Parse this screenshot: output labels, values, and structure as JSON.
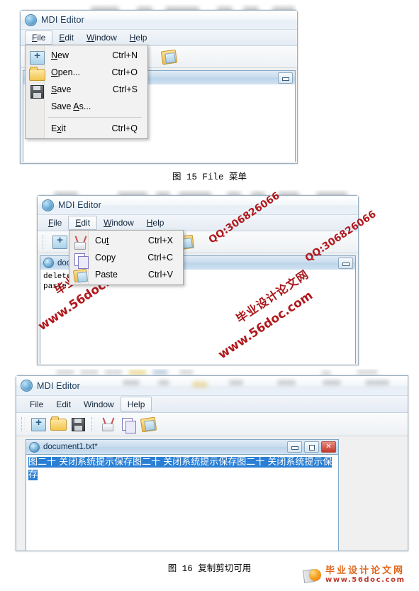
{
  "app": {
    "title": "MDI Editor",
    "app_icon": "globe-icon"
  },
  "menubar": {
    "items": [
      {
        "label": "File",
        "mnemonic": "F"
      },
      {
        "label": "Edit",
        "mnemonic": "E"
      },
      {
        "label": "Window",
        "mnemonic": "W"
      },
      {
        "label": "Help",
        "mnemonic": "H"
      }
    ]
  },
  "toolbar": {
    "buttons": [
      {
        "name": "new-icon",
        "tip": "New"
      },
      {
        "name": "open-icon",
        "tip": "Open"
      },
      {
        "name": "save-icon",
        "tip": "Save"
      },
      {
        "name": "cut-icon",
        "tip": "Cut"
      },
      {
        "name": "copy-icon",
        "tip": "Copy"
      },
      {
        "name": "paste-icon",
        "tip": "Paste"
      }
    ]
  },
  "figure1": {
    "selected_menu": "File",
    "menu_items": [
      {
        "label": "New",
        "pre": "N",
        "post": "ew",
        "accel": "Ctrl+N",
        "icon": "new-icon"
      },
      {
        "label": "Open...",
        "pre": "O",
        "post": "pen...",
        "accel": "Ctrl+O",
        "icon": "open-icon"
      },
      {
        "label": "Save",
        "pre": "S",
        "post": "ave",
        "accel": "Ctrl+S",
        "icon": "save-icon"
      },
      {
        "label": "Save As...",
        "pre": "",
        "post": "Save As...",
        "accel": "",
        "icon": "none"
      },
      {
        "label": "Exit",
        "pre": "E",
        "post": "xit",
        "accel": "Ctrl+Q",
        "icon": "none"
      }
    ],
    "caption_fig": "图 15",
    "caption_text": "File 菜单",
    "caption_full": "图 15 File 菜单"
  },
  "figure2": {
    "selected_menu": "Edit",
    "menu_items": [
      {
        "label": "Cut",
        "pre": "",
        "post": "Cut",
        "accel": "Ctrl+X",
        "icon": "cut-icon"
      },
      {
        "label": "Copy",
        "pre": "",
        "post": "Copy",
        "accel": "Ctrl+C",
        "icon": "copy-icon"
      },
      {
        "label": "Paste",
        "pre": "",
        "post": "Paste",
        "accel": "Ctrl+V",
        "icon": "paste-icon"
      }
    ],
    "document": {
      "title": "document1.txt*",
      "text": "delete\npaste"
    },
    "watermarks": [
      {
        "text": "www.56doc.com",
        "kind": "url"
      },
      {
        "text": "毕业设计论文网",
        "kind": "cn"
      },
      {
        "text": "QQ:306826066",
        "kind": "qq"
      }
    ]
  },
  "figure3": {
    "selected_menu": "Help",
    "document": {
      "title": "document1.txt*",
      "selected_text": "图二十 关闭系统提示保存图二十 关闭系统提示保存图二十 关闭系统提示保存",
      "selection_color": "#2a7fd4"
    },
    "window_buttons": [
      {
        "name": "minimize-button",
        "glyph": "minimize"
      },
      {
        "name": "maximize-button",
        "glyph": "maximize"
      },
      {
        "name": "close-button",
        "glyph": "✕"
      }
    ],
    "caption_fig": "图 16",
    "caption_text": "复制剪切可用",
    "caption_full": "图 16 复制剪切可用"
  },
  "footer_logo": {
    "cn": "毕业设计论文网",
    "url": "www.56doc.com"
  }
}
